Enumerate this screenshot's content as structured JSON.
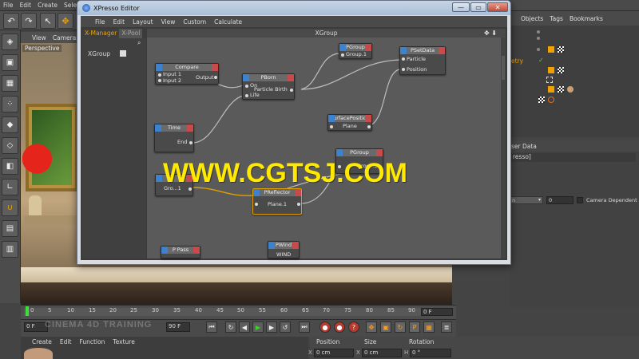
{
  "c4d": {
    "menu": [
      "File",
      "Edit",
      "Create",
      "Select"
    ],
    "viewport": {
      "tabs": [
        "View",
        "Cameras"
      ],
      "label": "Perspective"
    },
    "objects_tabs": [
      "Objects",
      "Tags",
      "Bookmarks"
    ],
    "objects_fragment": "etry",
    "attributes": {
      "title_fragment": "ser Data",
      "field_fragment": "resso]",
      "dropdown_fragment": "n",
      "number_value": "0",
      "checkbox_label": "Camera Dependent"
    },
    "timeline": {
      "ticks": [
        "0",
        "5",
        "10",
        "15",
        "20",
        "25",
        "30",
        "35",
        "40",
        "45",
        "50",
        "55",
        "60",
        "65",
        "70",
        "75",
        "80",
        "85",
        "90"
      ],
      "current_frame": "0 F",
      "start_field": "0 F",
      "end_field": "90 F"
    },
    "material_menu": [
      "Create",
      "Edit",
      "Function",
      "Texture"
    ],
    "coords": {
      "headers": [
        "Position",
        "Size",
        "Rotation"
      ],
      "x_pos": "0 cm",
      "x_size": "0 cm",
      "h_rot": "0 °",
      "axis_x": "X",
      "axis_x2": "X",
      "axis_h": "H"
    },
    "bottom_watermark": "CINEMA 4D TRAINING"
  },
  "xpresso": {
    "title": "XPresso Editor",
    "menu": [
      "File",
      "Edit",
      "Layout",
      "View",
      "Custom",
      "Calculate"
    ],
    "tabs": [
      "X-Manager",
      "X-Pool"
    ],
    "tree_item": "XGroup",
    "graph_title": "XGroup",
    "nodes": {
      "compare": {
        "title": "Compare",
        "in1": "Input 1",
        "in2": "Input 2",
        "out": "Output"
      },
      "pborn": {
        "title": "PBorn",
        "in1": "On",
        "in2": "Life",
        "out": "Particle Birth"
      },
      "pgroup1": {
        "title": "PGroup",
        "out": "Group.1"
      },
      "psetdata": {
        "title": "PSetData",
        "in1": "Particle",
        "in2": "Position"
      },
      "time": {
        "title": "Time",
        "out": "End"
      },
      "surface": {
        "title": "SurfacePosition",
        "in1": "Plane"
      },
      "pgroup2": {
        "title": "PGroup",
        "out": "Group.2"
      },
      "group_left": {
        "title": "",
        "out": "Gro...1"
      },
      "preflector": {
        "title": "PReflector",
        "in1": "Plane.1"
      },
      "ppass": {
        "title": "P Pass"
      },
      "pwind": {
        "title": "PWind",
        "in1": "WIND"
      }
    }
  },
  "watermark": "WWW.CGTSJ.COM",
  "colors": {
    "port_in": "#3d82cf",
    "port_out": "#c84a4a",
    "watermark": "#ffe900",
    "selected": "#e0a000"
  }
}
